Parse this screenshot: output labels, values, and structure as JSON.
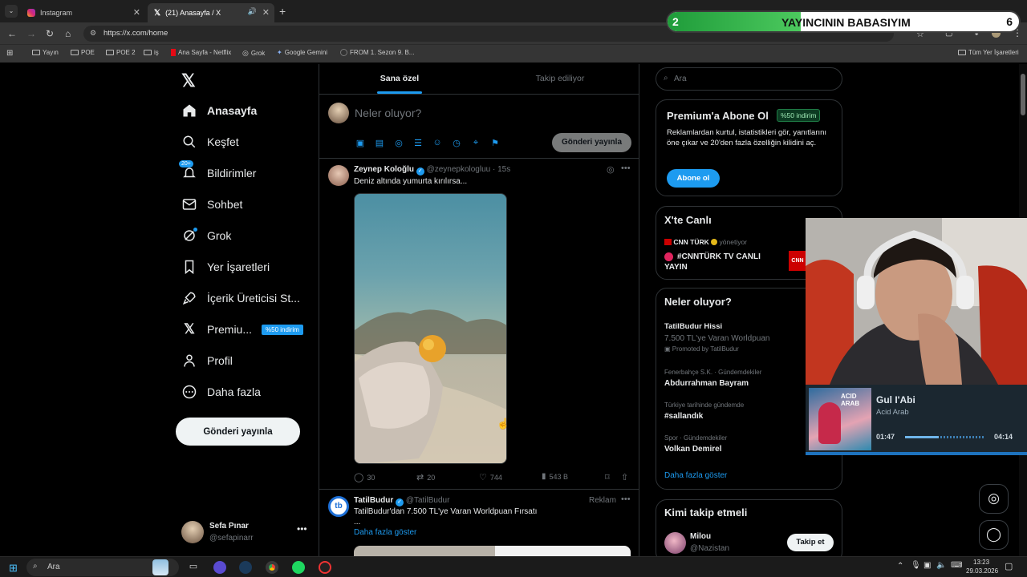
{
  "browser": {
    "tabs": [
      {
        "title": "Instagram",
        "active": false
      },
      {
        "title": "(21) Anasayfa / X",
        "active": true
      }
    ],
    "url": "https://x.com/home",
    "bookmarks": [
      "Yayın",
      "POE",
      "POE 2",
      "iş",
      "Ana Sayfa - Netflix",
      "Grok",
      "Google Gemini",
      "FROM 1. Sezon 9. B..."
    ],
    "all_bookmarks": "Tüm Yer İşaretleri"
  },
  "overlay": {
    "left_num": "2",
    "title": "YAYINCININ BABASIYIM",
    "right_num": "6",
    "progress": 0.38
  },
  "nav": {
    "items": [
      {
        "label": "Anasayfa"
      },
      {
        "label": "Keşfet"
      },
      {
        "label": "Bildirimler",
        "badge": "20+"
      },
      {
        "label": "Sohbet"
      },
      {
        "label": "Grok"
      },
      {
        "label": "Yer İşaretleri"
      },
      {
        "label": "İçerik Üreticisi St..."
      },
      {
        "label": "Premiu...",
        "badge": "%50 indirim"
      },
      {
        "label": "Profil"
      },
      {
        "label": "Daha fazla"
      }
    ],
    "post_button": "Gönderi yayınla",
    "user": {
      "name": "Sefa Pınar",
      "handle": "@sefapinarr"
    }
  },
  "timeline": {
    "tabs": [
      "Sana özel",
      "Takip ediliyor"
    ],
    "composer_placeholder": "Neler oluyor?",
    "composer_button": "Gönderi yayınla",
    "post1": {
      "name": "Zeynep Koloğlu",
      "handle": "@zeynepkologluu",
      "time": "· 15s",
      "text": "Deniz altında yumurta kırılırsa...",
      "replies": "30",
      "reposts": "20",
      "likes": "744",
      "views": "543 B"
    },
    "post2": {
      "name": "TatilBudur",
      "handle": "@TatilBudur",
      "ad": "Reklam",
      "text": "TatilBudur'dan 7.500 TL'ye Varan Worldpuan Fırsatı",
      "ellipsis": "...",
      "more": "Daha fazla göster"
    }
  },
  "sidebar": {
    "search_placeholder": "Ara",
    "premium": {
      "title": "Premium'a Abone Ol",
      "badge": "%50 indirim",
      "text": "Reklamlardan kurtul, istatistikleri gör, yanıtlarını öne çıkar ve 20'den fazla özelliğin kilidini aç.",
      "button": "Abone ol"
    },
    "live": {
      "title": "X'te Canlı",
      "host": "CNN TÜRK",
      "host_suffix": "yönetiyor",
      "text": "#CNNTÜRK TV CANLI YAYIN"
    },
    "trends": {
      "title": "Neler oluyor?",
      "items": [
        {
          "title": "TatilBudur Hissi",
          "sub": "7.500 TL'ye Varan Worldpuan",
          "meta": "Promoted by TatilBudur"
        },
        {
          "context": "Fenerbahçe S.K. · Gündemdekiler",
          "title": "Abdurrahman Bayram"
        },
        {
          "context": "Türkiye tarihinde gündemde",
          "title": "#sallandık"
        },
        {
          "context": "Spor · Gündemdekiler",
          "title": "Volkan Demirel"
        }
      ],
      "show_more": "Daha fazla göster"
    },
    "follow": {
      "title": "Kimi takip etmeli",
      "user": {
        "name": "Milou",
        "handle": "@Nazistan"
      },
      "button": "Takip et"
    }
  },
  "music": {
    "title": "Gul I'Abi",
    "artist": "Acid Arab",
    "elapsed": "01:47",
    "total": "04:14",
    "album_text": "ACID ARAB",
    "progress": 0.42
  },
  "taskbar": {
    "search": "Ara",
    "time": "13:23",
    "date": "29.03.2026"
  },
  "colors": {
    "accent": "#1d9bf0",
    "verified": "#1d9bf0",
    "overlay_green": "#2fb24a"
  }
}
